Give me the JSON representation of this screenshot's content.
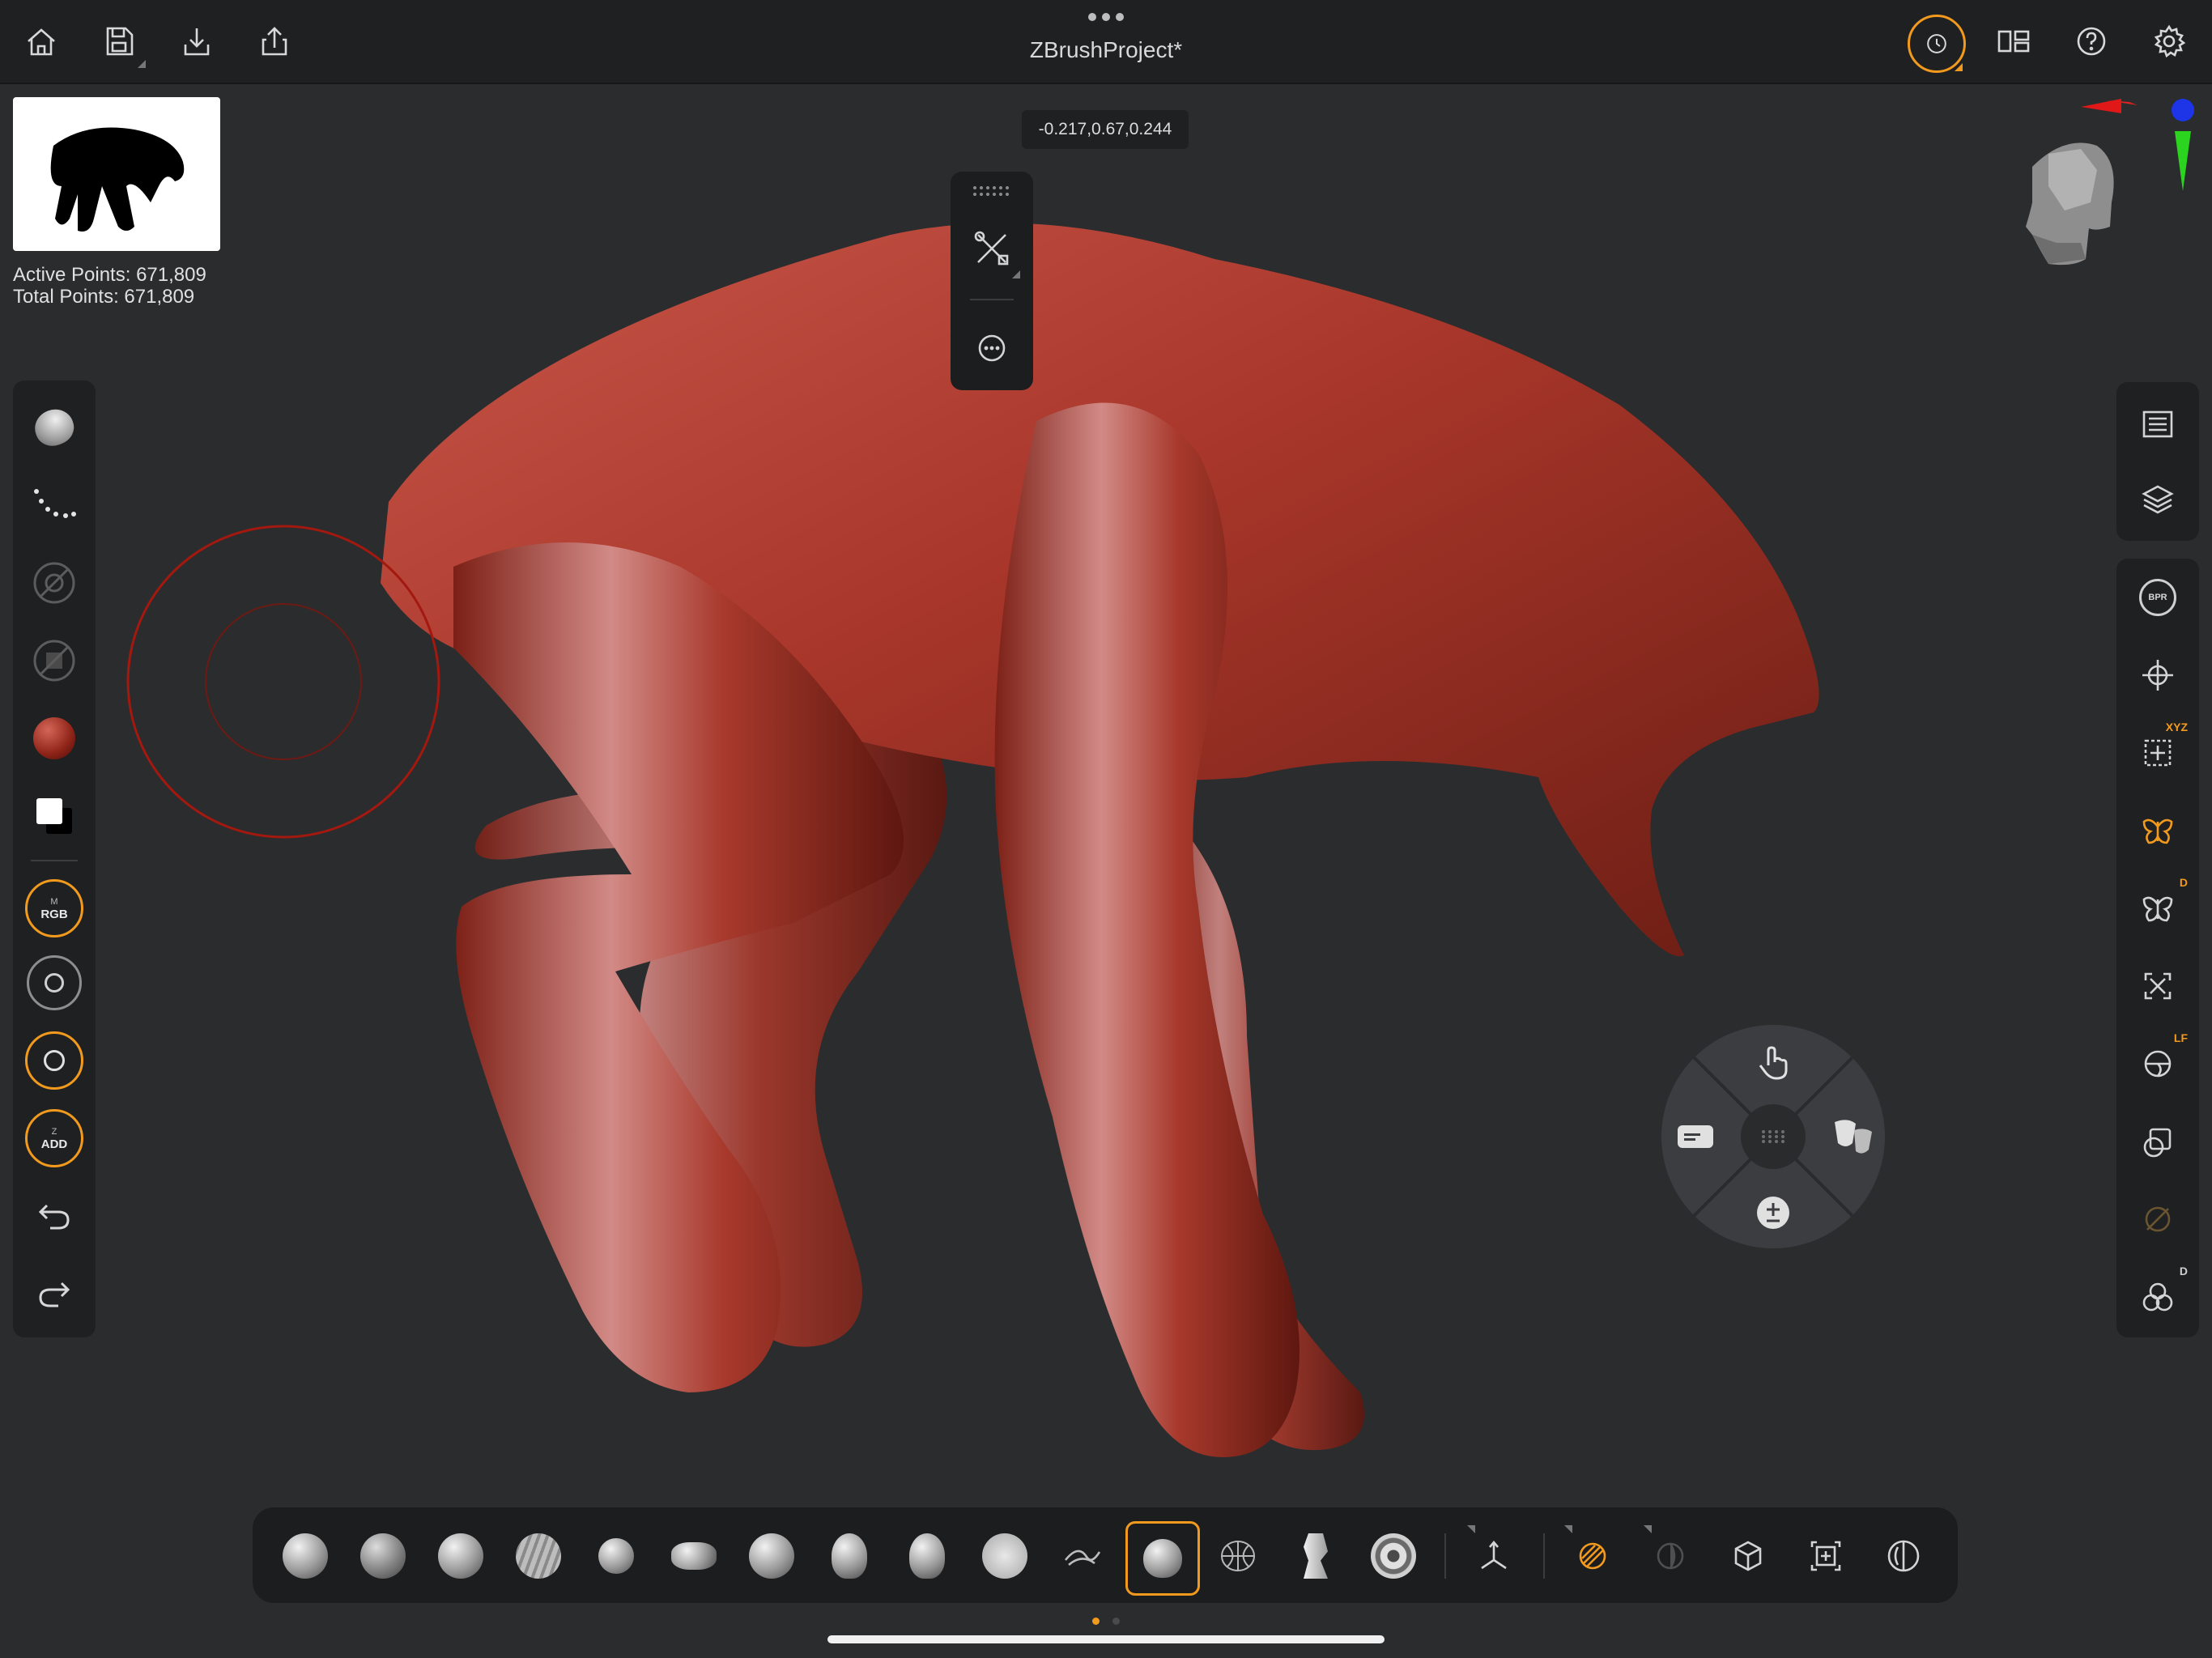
{
  "topbar": {
    "title": "ZBrushProject*",
    "left_icons": [
      "home-icon",
      "save-icon",
      "import-icon",
      "share-icon"
    ],
    "right_icons": [
      "history-icon",
      "layout-icon",
      "help-icon",
      "settings-icon"
    ]
  },
  "info": {
    "active_points": "Active Points: 671,809",
    "total_points": "Total Points: 671,809"
  },
  "coord_readout": "-0.217,0.67,0.244",
  "left_toolbar": {
    "items": [
      {
        "name": "brush-icon"
      },
      {
        "name": "stroke-icon"
      },
      {
        "name": "alpha-off-icon"
      },
      {
        "name": "texture-off-icon"
      },
      {
        "name": "material-icon"
      },
      {
        "name": "color-swatch"
      },
      {
        "name": "rgb-mode",
        "top": "M",
        "label": "RGB"
      },
      {
        "name": "focal-shift-icon"
      },
      {
        "name": "draw-size-icon"
      },
      {
        "name": "z-add-mode",
        "top": "Z",
        "label": "ADD"
      },
      {
        "name": "undo-icon"
      },
      {
        "name": "redo-icon"
      }
    ]
  },
  "right_toolbar": {
    "group1": [
      "list-icon",
      "layers-icon"
    ],
    "group2": [
      {
        "name": "bpr-icon",
        "label": "BPR"
      },
      {
        "name": "move-icon"
      },
      {
        "name": "symmetry-icon",
        "sup": "XYZ"
      },
      {
        "name": "butterfly-icon"
      },
      {
        "name": "butterfly-d-icon",
        "sup": "D"
      },
      {
        "name": "frame-icon"
      },
      {
        "name": "floor-icon",
        "sup": "LF"
      },
      {
        "name": "transparency-icon"
      },
      {
        "name": "disabled-icon"
      },
      {
        "name": "solo-icon",
        "sup": "D"
      }
    ]
  },
  "bottom_toolbar": {
    "brushes": [
      "standard-brush",
      "clay-brush",
      "clay-buildup-brush",
      "dam-standard-brush",
      "inflate-brush",
      "move-brush",
      "snake-hook-brush",
      "pinch-brush",
      "trim-brush",
      "smooth-brush",
      "polish-brush",
      "mask-brush",
      "curve-brush",
      "zmodeler-brush",
      "spiral-brush"
    ],
    "selected_index": 9,
    "tools": [
      "gizmo-icon",
      "polyframe-icon",
      "dynamic-icon",
      "mesh-icon",
      "dynamesh-icon",
      "transpose-icon"
    ]
  },
  "colors": {
    "accent": "#f29a1d",
    "model": "#a02a1e",
    "background": "#2b2c2e"
  }
}
